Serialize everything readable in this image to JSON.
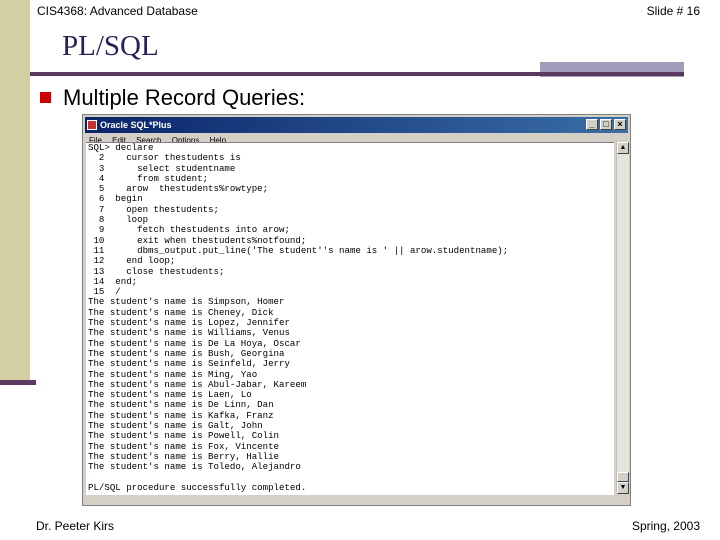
{
  "slide": {
    "course": "CIS4368: Advanced Database",
    "slide_number": "Slide # 16",
    "title": "PL/SQL",
    "bullet": "Multiple Record Queries:",
    "author": "Dr. Peeter Kirs",
    "term": "Spring, 2003",
    "colors": {
      "band": "#d2cfa2",
      "rule": "#5a3a5e",
      "accent": "#a09cb9",
      "bullet": "#cc0000",
      "title": "#2b1f5a"
    }
  },
  "window": {
    "title": "Oracle SQL*Plus",
    "controls": {
      "minimize": "_",
      "maximize": "□",
      "close": "×"
    },
    "menu": [
      "File",
      "Edit",
      "Search",
      "Options",
      "Help"
    ],
    "scroll_up": "▲",
    "scroll_down": "▼"
  },
  "console_lines": [
    "SQL> declare",
    "  2    cursor thestudents is",
    "  3      select studentname",
    "  4      from student;",
    "  5    arow  thestudents%rowtype;",
    "  6  begin",
    "  7    open thestudents;",
    "  8    loop",
    "  9      fetch thestudents into arow;",
    " 10      exit when thestudents%notfound;",
    " 11      dbms_output.put_line('The student''s name is ' || arow.studentname);",
    " 12    end loop;",
    " 13    close thestudents;",
    " 14  end;",
    " 15  /",
    "The student's name is Simpson, Homer",
    "The student's name is Cheney, Dick",
    "The student's name is Lopez, Jennifer",
    "The student's name is Williams, Venus",
    "The student's name is De La Hoya, Oscar",
    "The student's name is Bush, Georgina",
    "The student's name is Seinfeld, Jerry",
    "The student's name is Ming, Yao",
    "The student's name is Abul-Jabar, Kareem",
    "The student's name is Laen, Lo",
    "The student's name is De Linn, Dan",
    "The student's name is Kafka, Franz",
    "The student's name is Galt, John",
    "The student's name is Powell, Colin",
    "The student's name is Fox, Vincente",
    "The student's name is Berry, Hallie",
    "The student's name is Toledo, Alejandro",
    "",
    "PL/SQL procedure successfully completed.",
    ""
  ]
}
